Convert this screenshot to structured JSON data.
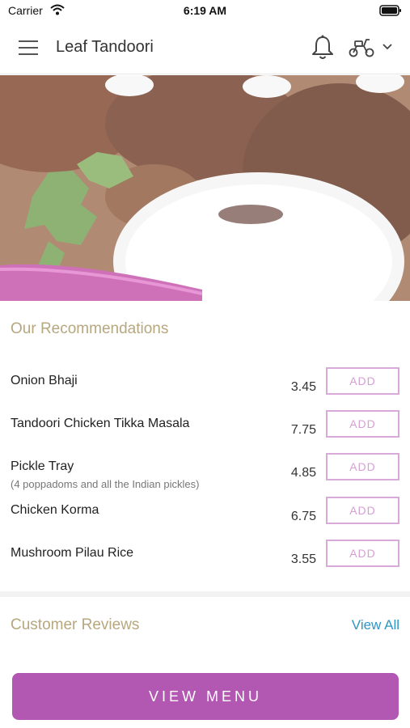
{
  "status_bar": {
    "carrier": "Carrier",
    "time": "6:19 AM"
  },
  "header": {
    "title": "Leaf Tandoori",
    "icons": [
      "menu-icon",
      "bell-icon",
      "scooter-icon",
      "chevron-down-icon"
    ]
  },
  "recommendations": {
    "title": "Our Recommendations",
    "add_label": "ADD",
    "items": [
      {
        "name": "Onion Bhaji",
        "description": "",
        "price": "3.45"
      },
      {
        "name": "Tandoori Chicken Tikka Masala",
        "description": "",
        "price": "7.75"
      },
      {
        "name": "Pickle Tray",
        "description": "(4 poppadoms and all the Indian pickles)",
        "price": "4.85"
      },
      {
        "name": "Chicken Korma",
        "description": "",
        "price": "6.75"
      },
      {
        "name": "Mushroom Pilau Rice",
        "description": "",
        "price": "3.55"
      }
    ]
  },
  "reviews": {
    "title": "Customer Reviews",
    "view_all_label": "View All"
  },
  "footer": {
    "view_menu_label": "VIEW MENU"
  },
  "colors": {
    "accent": "#b257b2",
    "add_border": "#d9a9d9",
    "heading_gold": "#b7a77f",
    "link_blue": "#2b97c6"
  }
}
